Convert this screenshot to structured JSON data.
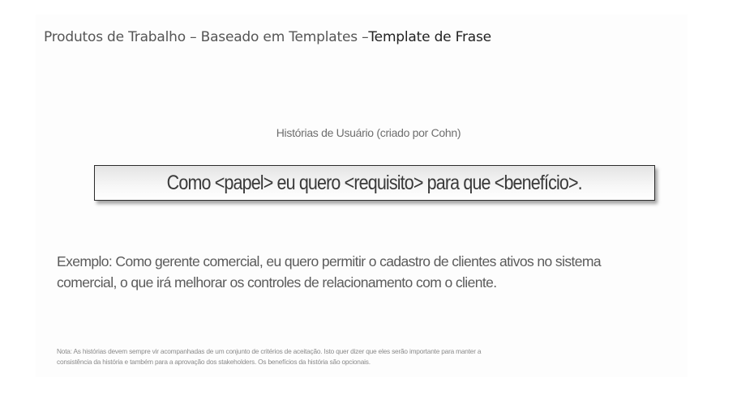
{
  "slide": {
    "title_regular": "Produtos de Trabalho – Baseado em Templates –",
    "title_bold": "Template de Frase",
    "subtitle": "Histórias de Usuário (criado por Cohn)",
    "template": "Como <papel> eu quero <requisito> para que <benefício>.",
    "example_line1": "Exemplo: Como gerente comercial, eu quero permitir o cadastro de clientes ativos no sistema",
    "example_line2": "comercial, o que irá melhorar os controles de relacionamento com o cliente.",
    "note_line1": "Nota: As histórias devem sempre vir acompanhadas  de um conjunto de critérios de aceitação. Isto quer dizer que eles serão importante para manter a",
    "note_line2": "consistência da história e também para a aprovação dos stakeholders. Os benefícios da história são opcionais."
  }
}
